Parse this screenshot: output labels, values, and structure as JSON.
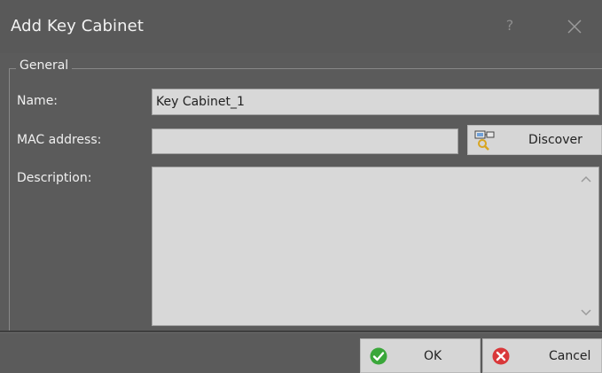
{
  "dialog": {
    "title": "Add Key Cabinet",
    "help_symbol": "?"
  },
  "group": {
    "title": "General"
  },
  "fields": {
    "name_label": "Name:",
    "name_value": "Key Cabinet_1",
    "mac_label": "MAC address:",
    "mac_value": "",
    "description_label": "Description:",
    "description_value": ""
  },
  "buttons": {
    "discover_label": "Discover",
    "ok_label": "OK",
    "cancel_label": "Cancel"
  },
  "icons": {
    "help": "help-icon",
    "close": "close-icon",
    "discover": "network-search-icon",
    "ok": "check-circle-icon",
    "cancel": "x-circle-icon"
  },
  "colors": {
    "ok_green": "#3aa73a",
    "cancel_red": "#d9383a",
    "background": "#5b5b5b"
  }
}
